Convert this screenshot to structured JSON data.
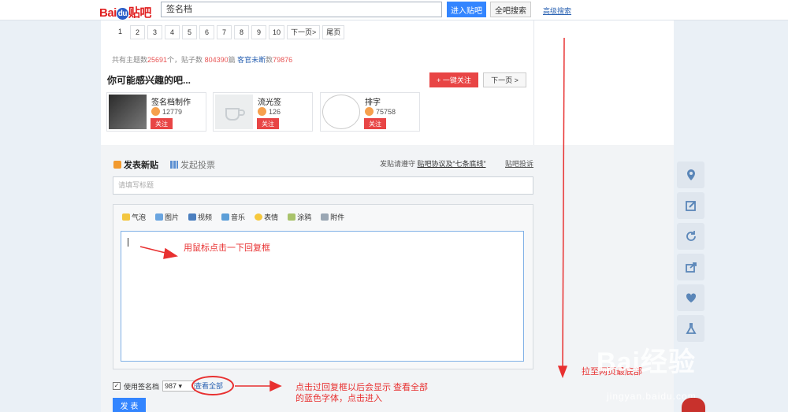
{
  "topbar": {
    "search_value": "签名档",
    "enter_btn": "进入贴吧",
    "all_btn": "全吧搜索",
    "advanced": "高级搜索"
  },
  "pager": [
    "1",
    "2",
    "3",
    "4",
    "5",
    "6",
    "7",
    "8",
    "9",
    "10",
    "下一页>",
    "尾页"
  ],
  "stats": {
    "prefix": "共有主题数",
    "topics": "25691",
    "mid1": "个，贴子数 ",
    "posts": "804390",
    "mid2": "篇 ",
    "members_label": "客官未断",
    "mid3": "数",
    "members": "79876"
  },
  "interest": {
    "title": "你可能感兴趣的吧...",
    "follow_all": "+ 一键关注",
    "next_batch": "下一页 >"
  },
  "cards": [
    {
      "name": "签名档制作",
      "fans": "12779",
      "follow": "关注"
    },
    {
      "name": "流光签",
      "fans": "126",
      "follow": "关注"
    },
    {
      "name": "排字",
      "fans": "75758",
      "follow": "关注"
    }
  ],
  "post": {
    "new_post": "发表新贴",
    "vote": "发起投票",
    "rules_prefix": "发贴请遵守 ",
    "rules_link": "贴吧协议及“七条底线”",
    "complain": "贴吧投诉",
    "title_placeholder": "请填写标题"
  },
  "toolbar": [
    "气泡",
    "图片",
    "视频",
    "音乐",
    "表情",
    "涂鸦",
    "附件"
  ],
  "annotations": {
    "click_box": "用鼠标点击一下回复框",
    "after_click_1": "点击过回复框以后会显示  查看全部",
    "after_click_2": "的蓝色字体，点击进入",
    "scroll": "拉至网页最底部"
  },
  "signature": {
    "label": "使用签名档",
    "value": "987",
    "view_all": "查看全部"
  },
  "publish": "发 表",
  "watermark": {
    "main": "Bai经验",
    "sub": "jingyan.baidu.com"
  },
  "colors": {
    "accent_blue": "#3385ff",
    "follow_red": "#e84545",
    "annotation_red": "#e83030"
  }
}
